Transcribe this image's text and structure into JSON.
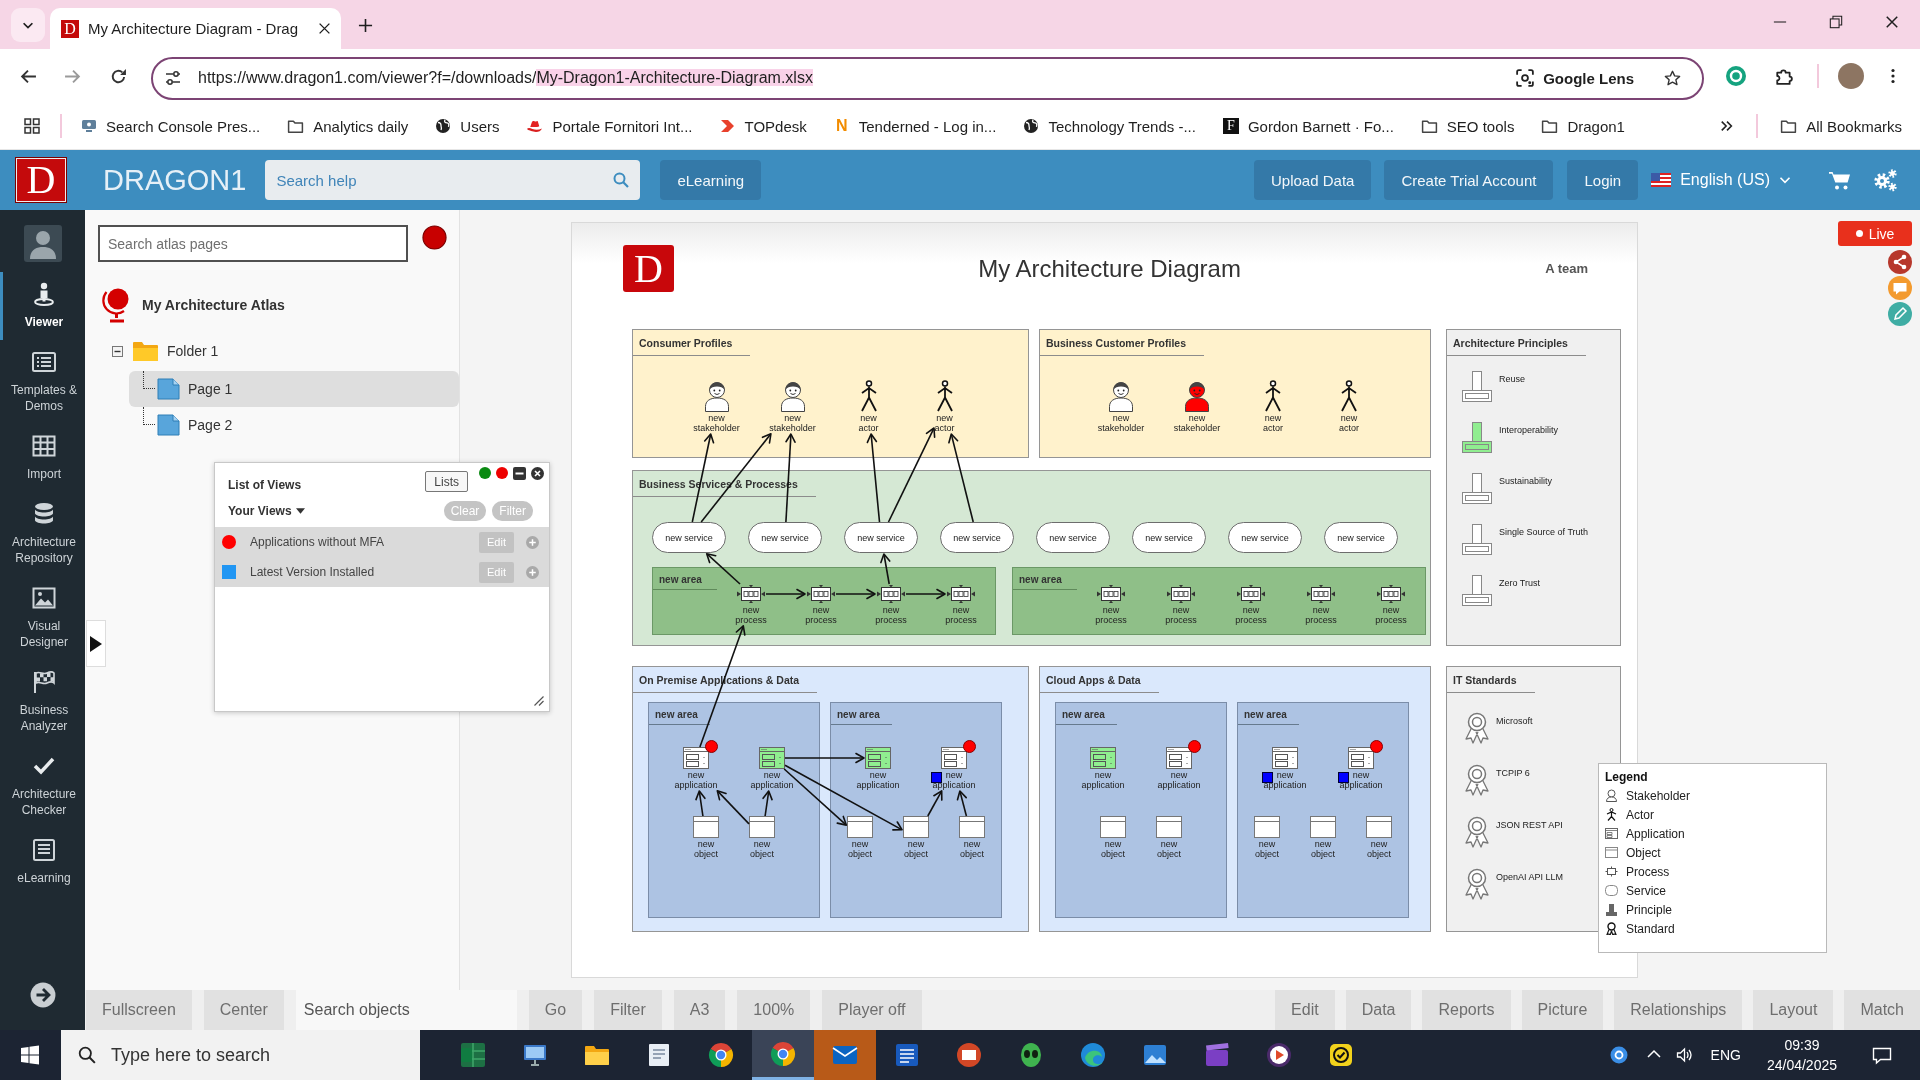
{
  "browser": {
    "tab": {
      "favicon_text": "D",
      "title": "My Architecture Diagram - Drag",
      "selected": true
    },
    "address": {
      "url_prefix": "https://www.dragon1.com/viewer?f=/downloads/",
      "url_highlight": "My-Dragon1-Architecture-Diagram.xlsx",
      "lens_label": "Google Lens"
    },
    "bookmarks": [
      {
        "kind": "console",
        "label": "Search Console Pres..."
      },
      {
        "kind": "folder",
        "label": "Analytics daily"
      },
      {
        "kind": "globe",
        "label": "Users"
      },
      {
        "kind": "hat",
        "label": "Portale Fornitori Int..."
      },
      {
        "kind": "chevron",
        "label": "TOPdesk"
      },
      {
        "kind": "letter",
        "favicon_text": "N",
        "label": "Tenderned - Log in..."
      },
      {
        "kind": "globe",
        "label": "Technology Trends -..."
      },
      {
        "kind": "tile",
        "favicon_text": "F",
        "label": "Gordon Barnett · Fo..."
      },
      {
        "kind": "folder",
        "label": "SEO tools"
      },
      {
        "kind": "folder",
        "label": "Dragon1"
      }
    ],
    "all_bookmarks": "All Bookmarks"
  },
  "header": {
    "logo_text": "D",
    "brand": "DRAGON1",
    "search": {
      "placeholder": "Search help"
    },
    "elearning": "eLearning",
    "actions": [
      "Upload Data",
      "Create Trial Account",
      "Login"
    ],
    "language": "English (US)"
  },
  "nav": {
    "items": [
      {
        "kind": "viewer",
        "label": "Viewer",
        "selected": true
      },
      {
        "kind": "templates",
        "label": "Templates & Demos",
        "selected": false
      },
      {
        "kind": "import",
        "label": "Import",
        "selected": false
      },
      {
        "kind": "repository",
        "label": "Architecture Repository",
        "selected": false
      },
      {
        "kind": "designer",
        "label": "Visual Designer",
        "selected": false
      },
      {
        "kind": "analyzer",
        "label": "Business Analyzer",
        "selected": false
      },
      {
        "kind": "checker",
        "label": "Architecture Checker",
        "selected": false
      },
      {
        "kind": "elearning",
        "label": "eLearning",
        "selected": false
      }
    ]
  },
  "atlas": {
    "search": {
      "placeholder": "Search atlas pages"
    },
    "title": "My Architecture Atlas",
    "tree": [
      {
        "kind": "folder",
        "label": "Folder 1",
        "selected": false,
        "expanded": true,
        "children": [
          {
            "kind": "page",
            "label": "Page 1",
            "selected": true
          },
          {
            "kind": "page",
            "label": "Page 2",
            "selected": false
          }
        ]
      }
    ]
  },
  "views_panel": {
    "title": "List of Views",
    "lists_button": "Lists",
    "menu": "Your Views",
    "actions": [
      "Clear",
      "Filter"
    ],
    "views": [
      {
        "kind": "dot",
        "color": "#ff0000",
        "name": "Applications without MFA",
        "edit": "Edit"
      },
      {
        "kind": "square",
        "color": "#2196f3",
        "name": "Latest Version Installed",
        "edit": "Edit"
      }
    ]
  },
  "diagram": {
    "logo_text": "D",
    "title": "My Architecture Diagram",
    "owner": "A team",
    "lanes": [
      {
        "kind": "profiles",
        "title": "Consumer Profiles",
        "nodes": [
          {
            "kind": "stakeholder",
            "label": "new stakeholder",
            "color": "#ffffff"
          },
          {
            "kind": "stakeholder",
            "label": "new stakeholder",
            "color": "#ffffff"
          },
          {
            "kind": "actor",
            "label": "new actor"
          },
          {
            "kind": "actor",
            "label": "new actor"
          }
        ]
      },
      {
        "kind": "profiles",
        "title": "Business Customer Profiles",
        "nodes": [
          {
            "kind": "stakeholder",
            "label": "new stakeholder",
            "color": "#ffffff"
          },
          {
            "kind": "stakeholder",
            "label": "new stakeholder",
            "color": "#ff0000"
          },
          {
            "kind": "actor",
            "label": "new actor"
          },
          {
            "kind": "actor",
            "label": "new actor"
          }
        ]
      },
      {
        "kind": "principles",
        "title": "Architecture Principles",
        "items": [
          {
            "label": "Reuse",
            "color": "#ffffff"
          },
          {
            "label": "Interoperability",
            "color": "#90ee90"
          },
          {
            "label": "Sustainability",
            "color": "#ffffff"
          },
          {
            "label": "Single Source of Truth",
            "color": "#ffffff"
          },
          {
            "label": "Zero Trust",
            "color": "#ffffff"
          }
        ]
      },
      {
        "kind": "services",
        "title": "Business Services & Processes",
        "services": [
          {
            "label": "new service"
          },
          {
            "label": "new service"
          },
          {
            "label": "new service"
          },
          {
            "label": "new service"
          },
          {
            "label": "new service"
          },
          {
            "label": "new service"
          },
          {
            "label": "new service"
          },
          {
            "label": "new service"
          }
        ],
        "areas": [
          {
            "title": "new area",
            "processes": [
              {
                "label": "new process"
              },
              {
                "label": "new process"
              },
              {
                "label": "new process"
              },
              {
                "label": "new process"
              }
            ]
          },
          {
            "title": "new area",
            "processes": [
              {
                "label": "new process"
              },
              {
                "label": "new process"
              },
              {
                "label": "new process"
              },
              {
                "label": "new process"
              },
              {
                "label": "new process"
              }
            ]
          }
        ]
      },
      {
        "kind": "applications",
        "title": "On Premise Applications & Data",
        "areas": [
          {
            "title": "new area",
            "applications": [
              {
                "label": "new application",
                "color": "#ffffff",
                "without_mfa": true,
                "latest_version": false
              },
              {
                "label": "new application",
                "color": "#90ee90",
                "without_mfa": false,
                "latest_version": false
              }
            ],
            "objects": [
              {
                "label": "new object"
              },
              {
                "label": "new object"
              }
            ]
          },
          {
            "title": "new area",
            "applications": [
              {
                "label": "new application",
                "color": "#90ee90",
                "without_mfa": false,
                "latest_version": false
              },
              {
                "label": "new application",
                "color": "#ffffff",
                "without_mfa": true,
                "latest_version": true
              }
            ],
            "objects": [
              {
                "label": "new object"
              },
              {
                "label": "new object"
              },
              {
                "label": "new object"
              }
            ]
          }
        ]
      },
      {
        "kind": "applications",
        "title": "Cloud Apps & Data",
        "areas": [
          {
            "title": "new area",
            "applications": [
              {
                "label": "new application",
                "color": "#90ee90",
                "without_mfa": false,
                "latest_version": false
              },
              {
                "label": "new application",
                "color": "#ffffff",
                "without_mfa": true,
                "latest_version": false
              }
            ],
            "objects": [
              {
                "label": "new object"
              },
              {
                "label": "new object"
              }
            ]
          },
          {
            "title": "new area",
            "applications": [
              {
                "label": "new application",
                "color": "#ffffff",
                "without_mfa": false,
                "latest_version": true
              },
              {
                "label": "new application",
                "color": "#ffffff",
                "without_mfa": true,
                "latest_version": true
              }
            ],
            "objects": [
              {
                "label": "new object"
              },
              {
                "label": "new object"
              },
              {
                "label": "new object"
              }
            ]
          }
        ]
      },
      {
        "kind": "standards",
        "title": "IT Standards",
        "items": [
          {
            "label": "Microsoft"
          },
          {
            "label": "TCPIP 6"
          },
          {
            "label": "JSON REST API"
          },
          {
            "label": "OpenAI API LLM"
          }
        ]
      }
    ]
  },
  "viewer_controls": {
    "live": "Live"
  },
  "legend": {
    "title": "Legend",
    "items": [
      {
        "kind": "stakeholder",
        "label": "Stakeholder"
      },
      {
        "kind": "actor",
        "label": "Actor"
      },
      {
        "kind": "application",
        "label": "Application"
      },
      {
        "kind": "object",
        "label": "Object"
      },
      {
        "kind": "process",
        "label": "Process"
      },
      {
        "kind": "service",
        "label": "Service"
      },
      {
        "kind": "principle",
        "label": "Principle"
      },
      {
        "kind": "standard",
        "label": "Standard"
      }
    ]
  },
  "bottom_toolbar": {
    "left": [
      {
        "kind": "button",
        "label": "Fullscreen"
      },
      {
        "kind": "button",
        "label": "Center"
      },
      {
        "kind": "search",
        "placeholder": "Search objects"
      },
      {
        "kind": "button",
        "label": "Go"
      },
      {
        "kind": "button",
        "label": "Filter"
      },
      {
        "kind": "button",
        "label": "A3"
      },
      {
        "kind": "button",
        "label": "100%"
      },
      {
        "kind": "button",
        "label": "Player off"
      }
    ],
    "right": [
      {
        "kind": "button",
        "label": "Edit"
      },
      {
        "kind": "button",
        "label": "Data"
      },
      {
        "kind": "button",
        "label": "Reports"
      },
      {
        "kind": "button",
        "label": "Picture"
      },
      {
        "kind": "button",
        "label": "Relationships"
      },
      {
        "kind": "button",
        "label": "Layout"
      },
      {
        "kind": "button",
        "label": "Match"
      }
    ]
  },
  "taskbar": {
    "search": {
      "placeholder": "Type here to search"
    },
    "apps": [
      {
        "kind": "sheet",
        "active": false,
        "attention": false
      },
      {
        "kind": "computer",
        "active": false,
        "attention": false
      },
      {
        "kind": "files",
        "active": false,
        "attention": false
      },
      {
        "kind": "drive",
        "active": false,
        "attention": false
      },
      {
        "kind": "browser",
        "active": false,
        "attention": false
      },
      {
        "kind": "browser",
        "active": true,
        "attention": false
      },
      {
        "kind": "mail",
        "active": false,
        "attention": true
      },
      {
        "kind": "doc",
        "active": false,
        "attention": false
      },
      {
        "kind": "slides",
        "active": false,
        "attention": false
      },
      {
        "kind": "game",
        "active": false,
        "attention": false
      },
      {
        "kind": "web",
        "active": false,
        "attention": false
      },
      {
        "kind": "photos",
        "active": false,
        "attention": false
      },
      {
        "kind": "video",
        "active": false,
        "attention": false
      },
      {
        "kind": "player",
        "active": false,
        "attention": false
      },
      {
        "kind": "check",
        "active": false,
        "attention": false
      }
    ],
    "language": "ENG",
    "time": "09:39",
    "date": "24/04/2025"
  }
}
